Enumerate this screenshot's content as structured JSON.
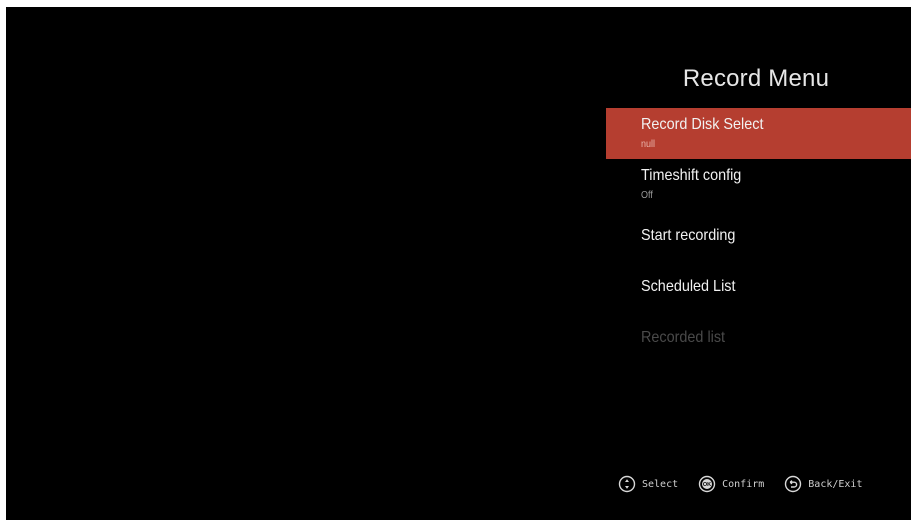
{
  "menu": {
    "title": "Record Menu",
    "items": [
      {
        "label": "Record Disk Select",
        "value": "null"
      },
      {
        "label": "Timeshift config",
        "value": "Off"
      },
      {
        "label": "Start recording"
      },
      {
        "label": "Scheduled List"
      },
      {
        "label": "Recorded list"
      }
    ],
    "selected_color": "#b53e30"
  },
  "hints": {
    "select": {
      "icon": "updown-circle-icon",
      "label": "Select"
    },
    "confirm": {
      "icon": "ok-circle-icon",
      "label": "Confirm"
    },
    "back": {
      "icon": "back-arrow-circle-icon",
      "label": "Back/Exit"
    }
  }
}
